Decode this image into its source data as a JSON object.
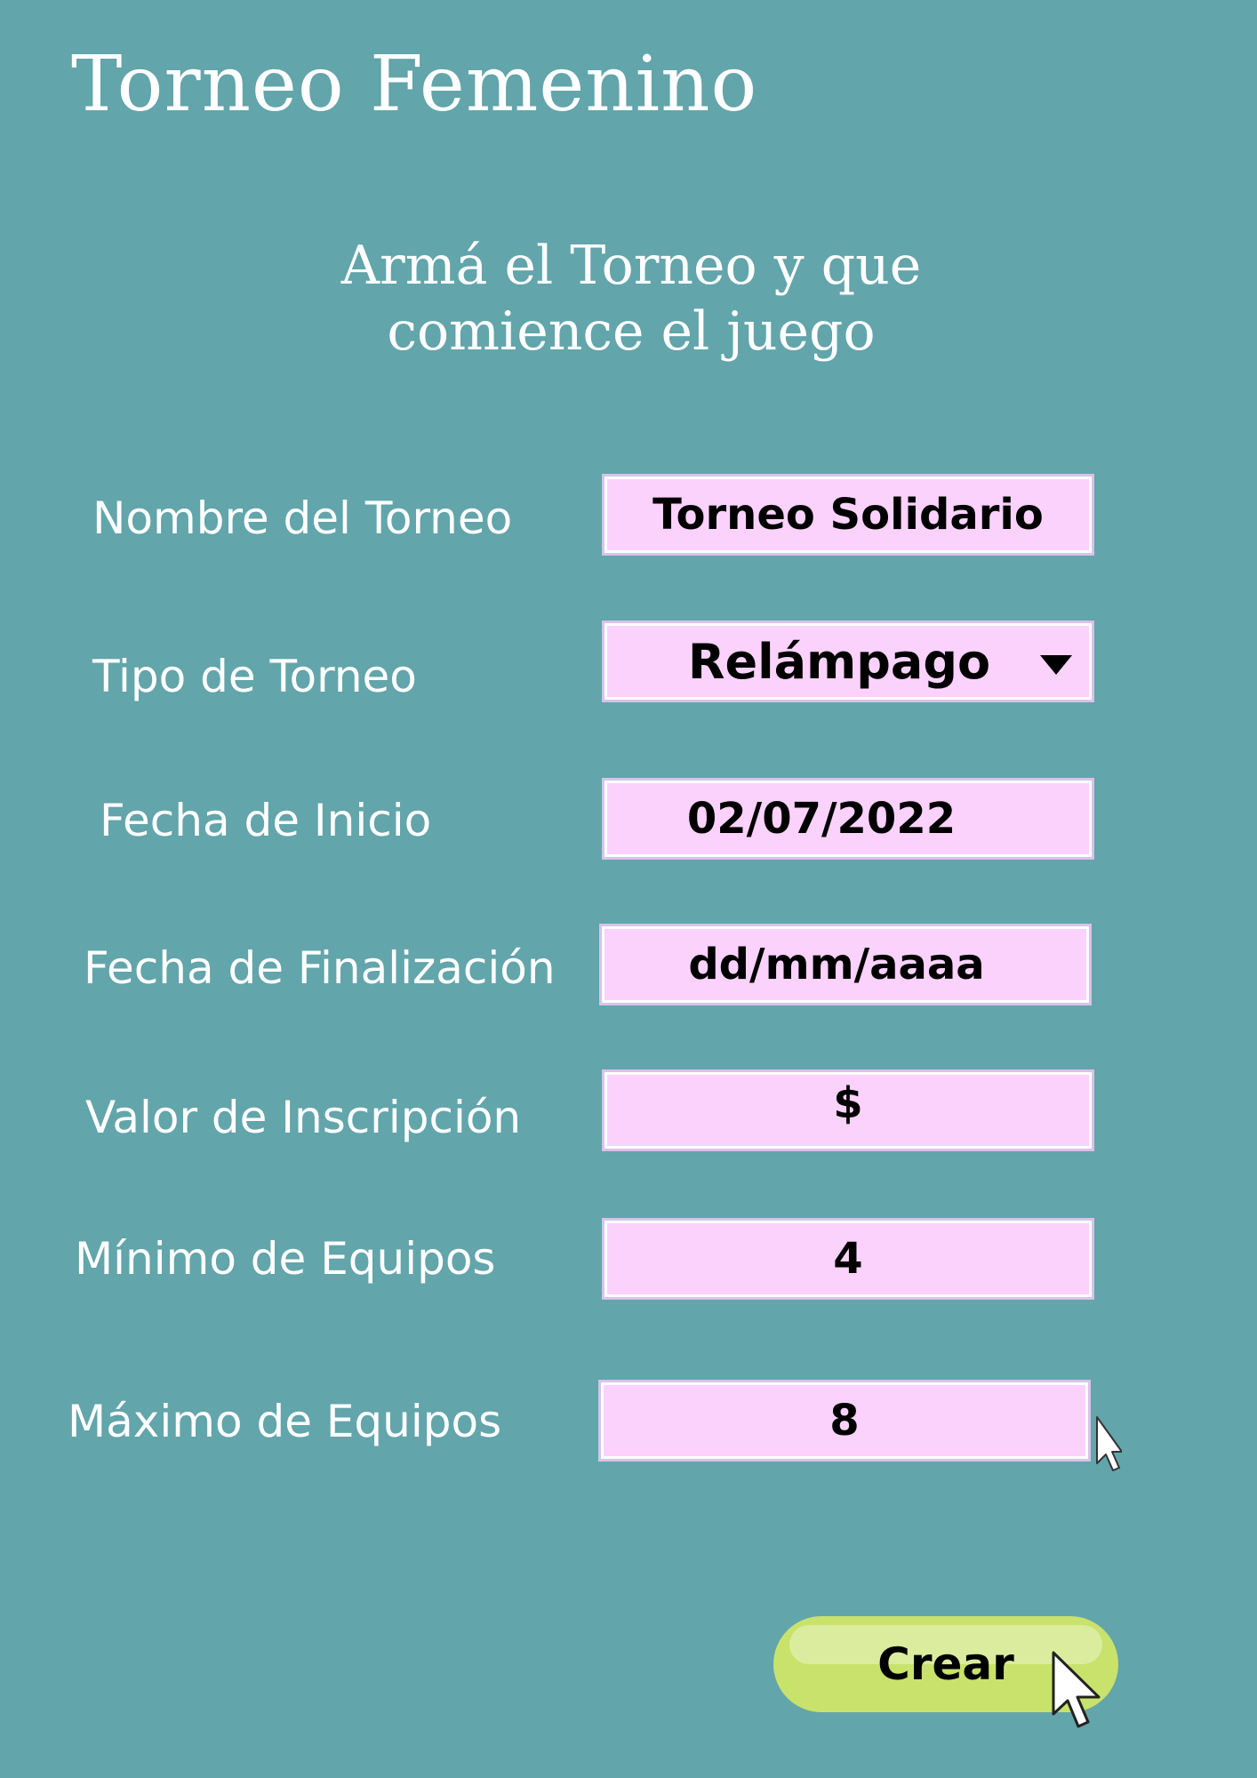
{
  "app": {
    "title": "Torneo Femenino",
    "subtitle_line1": "Armá el Torneo y que",
    "subtitle_line2": "comience el juego"
  },
  "form": {
    "fields": [
      {
        "label": "Nombre del Torneo",
        "value": "Torneo Solidario"
      },
      {
        "label": "Tipo de Torneo",
        "value": "Relámpago"
      },
      {
        "label": "Fecha de Inicio",
        "value": "02/07/2022"
      },
      {
        "label": "Fecha de Finalización",
        "value": "dd/mm/aaaa"
      },
      {
        "label": "Valor de Inscripción",
        "value": "$"
      },
      {
        "label": "Mínimo de Equipos",
        "value": "4"
      },
      {
        "label": "Máximo de Equipos",
        "value": "8"
      }
    ],
    "submit_label": "Crear"
  },
  "colors": {
    "background": "#62a5ab",
    "field_fill": "#fad2fb",
    "field_border": "#d8c3ea",
    "button": "#c8e26b"
  },
  "icons": {
    "dropdown": "triangle-down",
    "cursor": "mouse-pointer-arrow"
  }
}
